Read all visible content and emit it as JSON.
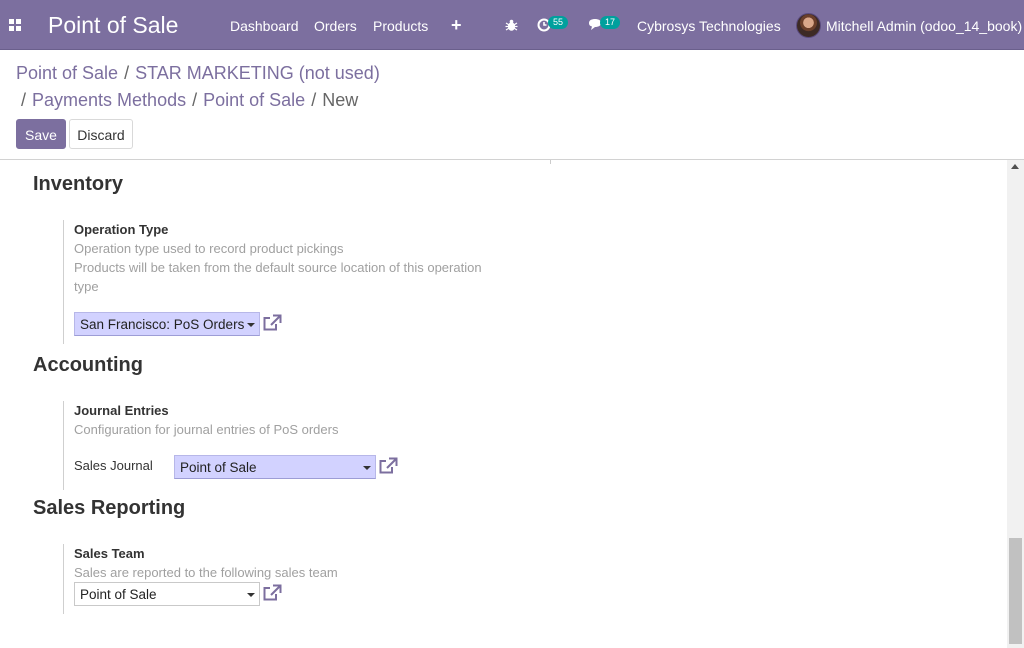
{
  "navbar": {
    "app_title": "Point of Sale",
    "menu": [
      "Dashboard",
      "Orders",
      "Products"
    ],
    "activity_count": "55",
    "message_count": "17",
    "company": "Cybrosys Technologies",
    "user": "Mitchell Admin (odoo_14_book)"
  },
  "breadcrumb": {
    "item1": "Point of Sale",
    "item2": "STAR MARKETING (not used)",
    "item3": "Payments Methods",
    "item4": "Point of Sale",
    "current": "New",
    "separator": "/"
  },
  "buttons": {
    "save": "Save",
    "discard": "Discard"
  },
  "sections": {
    "inventory": {
      "title": "Inventory",
      "setting_label": "Operation Type",
      "help1": "Operation type used to record product pickings",
      "help2": "Products will be taken from the default source location of this operation type",
      "value": "San Francisco: PoS Orders"
    },
    "accounting": {
      "title": "Accounting",
      "setting_label": "Journal Entries",
      "help": "Configuration for journal entries of PoS orders",
      "field_label": "Sales Journal",
      "value": "Point of Sale"
    },
    "sales_reporting": {
      "title": "Sales Reporting",
      "setting_label": "Sales Team",
      "help": "Sales are reported to the following sales team",
      "value": "Point of Sale"
    }
  },
  "colors": {
    "brand": "#7c6f9f",
    "required_field": "#d2d2ff",
    "badge": "#00a09d"
  }
}
